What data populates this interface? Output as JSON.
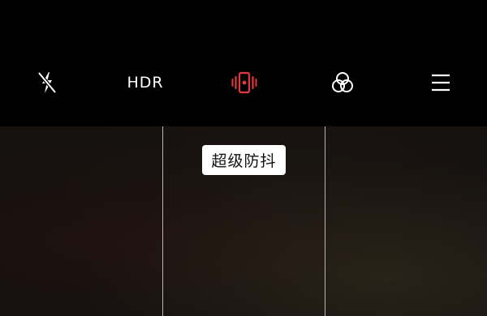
{
  "toolbar": {
    "flash": {
      "icon": "flash-off-icon",
      "state": "off"
    },
    "hdr": {
      "label": "HDR",
      "state": "off"
    },
    "stabilization": {
      "icon": "super-stabilization-icon",
      "state": "on",
      "active_color": "#e0393e"
    },
    "filters": {
      "icon": "filters-icon"
    },
    "menu": {
      "icon": "menu-icon"
    }
  },
  "toast": {
    "text": "超级防抖"
  },
  "viewfinder": {
    "grid": "thirds-vertical"
  }
}
